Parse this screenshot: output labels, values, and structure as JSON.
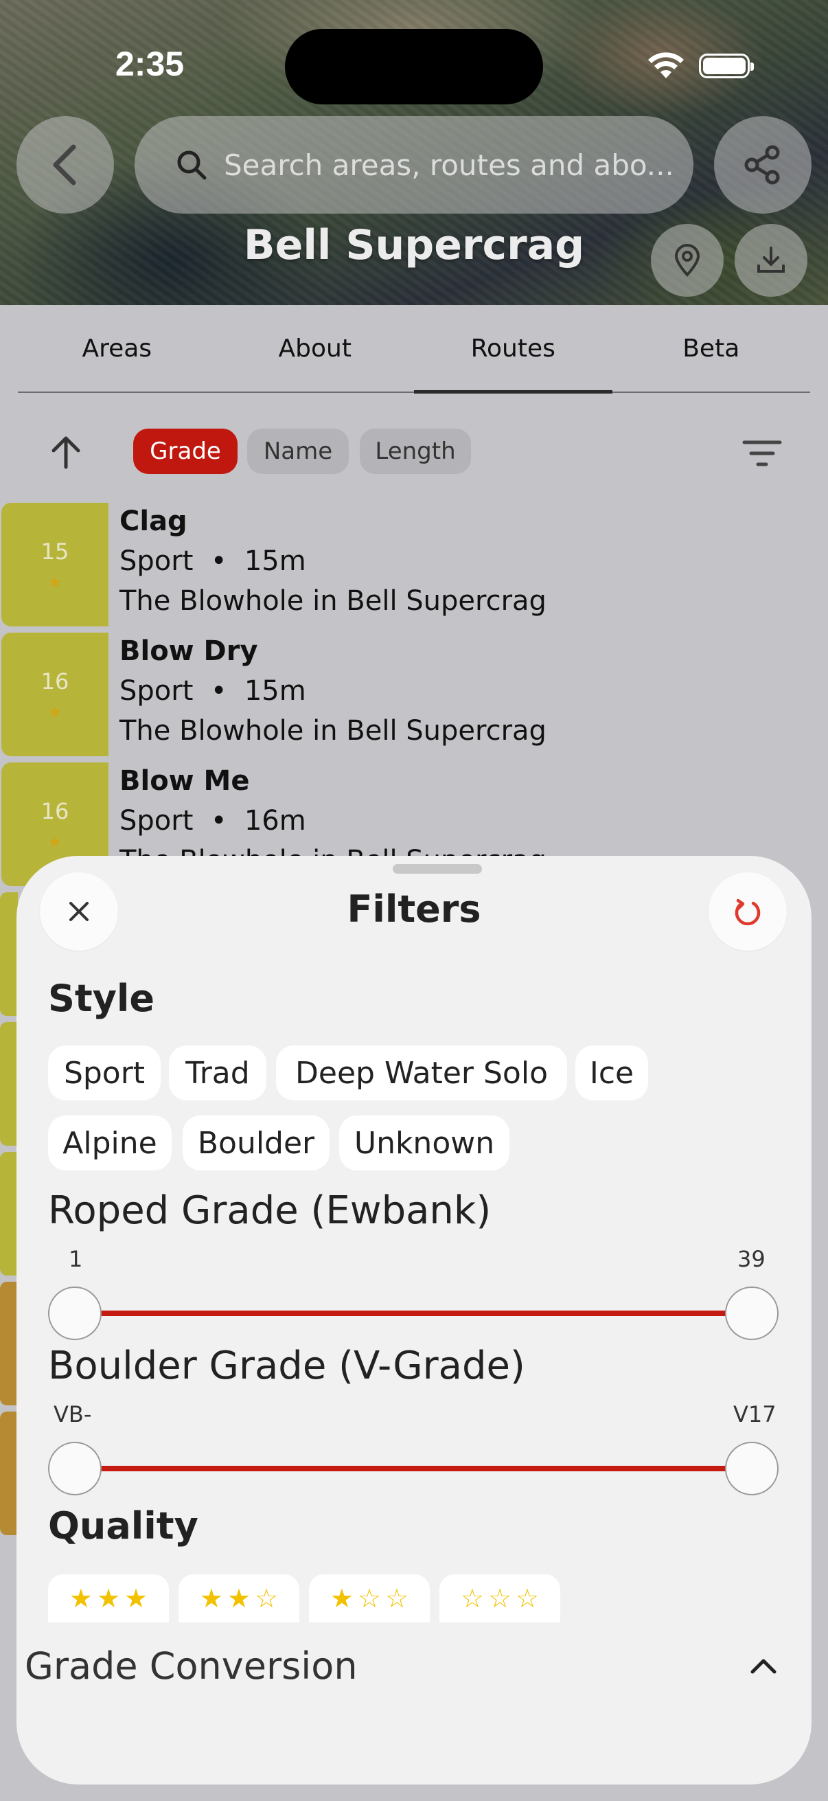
{
  "status_bar": {
    "time": "2:35"
  },
  "header": {
    "title": "Bell Supercrag",
    "search_placeholder": "Search areas, routes and abo..."
  },
  "tabs": [
    {
      "label": "Areas",
      "active": false
    },
    {
      "label": "About",
      "active": false
    },
    {
      "label": "Routes",
      "active": true
    },
    {
      "label": "Beta",
      "active": false
    }
  ],
  "sort": {
    "options": [
      {
        "label": "Grade",
        "active": true
      },
      {
        "label": "Name",
        "active": false
      },
      {
        "label": "Length",
        "active": false
      }
    ]
  },
  "routes": [
    {
      "grade": "15",
      "stars": "★",
      "name": "Clag",
      "style": "Sport",
      "length": "15m",
      "location": "The Blowhole in Bell Supercrag"
    },
    {
      "grade": "16",
      "stars": "★",
      "name": "Blow Dry",
      "style": "Sport",
      "length": "15m",
      "location": "The Blowhole in Bell Supercrag"
    },
    {
      "grade": "16",
      "stars": "★",
      "name": "Blow Me",
      "style": "Sport",
      "length": "16m",
      "location": "The Blowhole in Bell Supercrag"
    }
  ],
  "meta_separator": "•",
  "filters": {
    "title": "Filters",
    "style_heading": "Style",
    "styles": [
      "Sport",
      "Trad",
      "Deep Water Solo",
      "Ice",
      "Alpine",
      "Boulder",
      "Unknown"
    ],
    "roped_grade": {
      "heading": "Roped Grade (Ewbank)",
      "min_label": "1",
      "max_label": "39"
    },
    "boulder_grade": {
      "heading": "Boulder Grade (V-Grade)",
      "min_label": "VB-",
      "max_label": "V17"
    },
    "quality_heading": "Quality",
    "quality_options": [
      {
        "filled": 3,
        "empty": 0
      },
      {
        "filled": 2,
        "empty": 1
      },
      {
        "filled": 1,
        "empty": 2
      },
      {
        "filled": 0,
        "empty": 3
      }
    ],
    "grade_conversion_label": "Grade Conversion"
  },
  "colors": {
    "accent_red": "#c0180f",
    "grade_yellow": "#b7b43a",
    "grade_orange": "#b58a32",
    "star_gold": "#f2c200"
  }
}
